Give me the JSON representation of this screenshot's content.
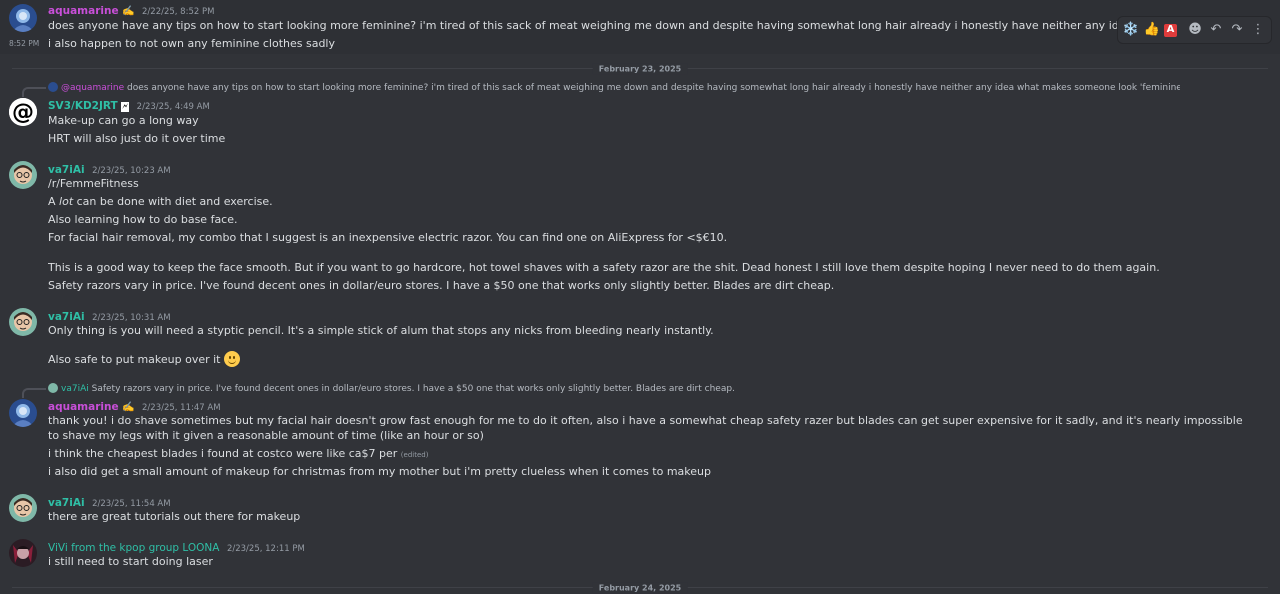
{
  "messages": {
    "m1": {
      "user": "aquamarine",
      "badge": "✍️",
      "time": "2/22/25, 8:52 PM",
      "text": "does anyone have any tips on how to start looking more feminine? i'm tired of this sack of meat weighing me down and despite having somewhat long hair already i honestly have neither any idea what makes someone look 'feminine' n"
    },
    "m1b": {
      "side_time": "8:52 PM",
      "text": "i also happen to not own any feminine clothes sadly"
    },
    "divider1": "February 23, 2025",
    "m2": {
      "reply_user": "@aquamarine",
      "reply_text": "does anyone have any tips on how to start looking more feminine? i'm tired of this sack of meat weighing me down and despite having somewhat long hair already i honestly have neither any idea what makes someone look 'feminine' nor any idea where to start",
      "avatar_symbol": "@",
      "user": "SV3/KD2JRT",
      "badge": "🗲",
      "time": "2/23/25, 4:49 AM",
      "lines": [
        "Make-up can go a long way",
        "HRT will also just do it over time"
      ]
    },
    "m3": {
      "user": "va7iAi",
      "time": "2/23/25, 10:23 AM",
      "l1": "/r/FemmeFitness",
      "l2a": "A ",
      "l2b": "lot",
      "l2c": " can be done with diet and exercise.",
      "l3": "Also learning how to do base face.",
      "l4": "For facial hair removal, my combo that I suggest is an inexpensive electric razor. You can find one on AliExpress for <$€10.",
      "l5": "This is a good way to keep the face smooth. But if you want to go hardcore, hot towel shaves with a safety razor are the shit. Dead honest I still love them despite hoping I never need to do them again.",
      "l6": "Safety razors vary in price. I've found decent ones in dollar/euro stores. I have a $50 one  that works only slightly better. Blades are dirt cheap."
    },
    "m4": {
      "user": "va7iAi",
      "time": "2/23/25, 10:31 AM",
      "l1": "Only thing is you will need a styptic pencil. It's a simple stick of alum that stops any nicks from bleeding nearly instantly.",
      "l2": "Also safe to put makeup over it"
    },
    "m5": {
      "reply_user": "va7iAi",
      "reply_text": "Safety razors vary in price. I've found decent ones in dollar/euro stores. I have a $50 one  that works only slightly better. Blades are dirt cheap.",
      "user": "aquamarine",
      "badge": "✍️",
      "time": "2/23/25, 11:47 AM",
      "l1": "thank you! i do shave sometimes but my facial hair doesn't grow fast enough for me to do it often, also i have a somewhat cheap safety razer but blades can get super expensive for it sadly, and it's nearly impossible to shave my legs with it given a reasonable amount of time (like an hour or so)",
      "l2": "i think the cheapest blades i found at costco were like ca$7 per ",
      "edited": "(edited)",
      "l3": "i also did get a small amount of makeup for christmas from my mother but i'm pretty clueless when it comes to makeup"
    },
    "m6": {
      "user": "va7iAi",
      "time": "2/23/25, 11:54 AM",
      "text": "there are great tutorials out there for makeup"
    },
    "m7": {
      "user": "ViVi from the kpop group LOONA",
      "time": "2/23/25, 12:11 PM",
      "text": "i still need to start doing laser"
    },
    "divider2": "February 24, 2025"
  },
  "toolbar": {
    "icons": [
      "snowflake-icon",
      "thumbs-up-icon",
      "a-button-icon",
      "add-reaction-icon",
      "reply-icon",
      "forward-icon",
      "more-icon"
    ],
    "snow": "❄️",
    "thumb": "👍",
    "a": "A",
    "react": "☻",
    "reply": "↶",
    "fwd": "↷",
    "more": "⋮"
  },
  "colors": {
    "background": "#313338",
    "pink_user": "#c84fd8",
    "teal_user": "#2fbfa6"
  }
}
